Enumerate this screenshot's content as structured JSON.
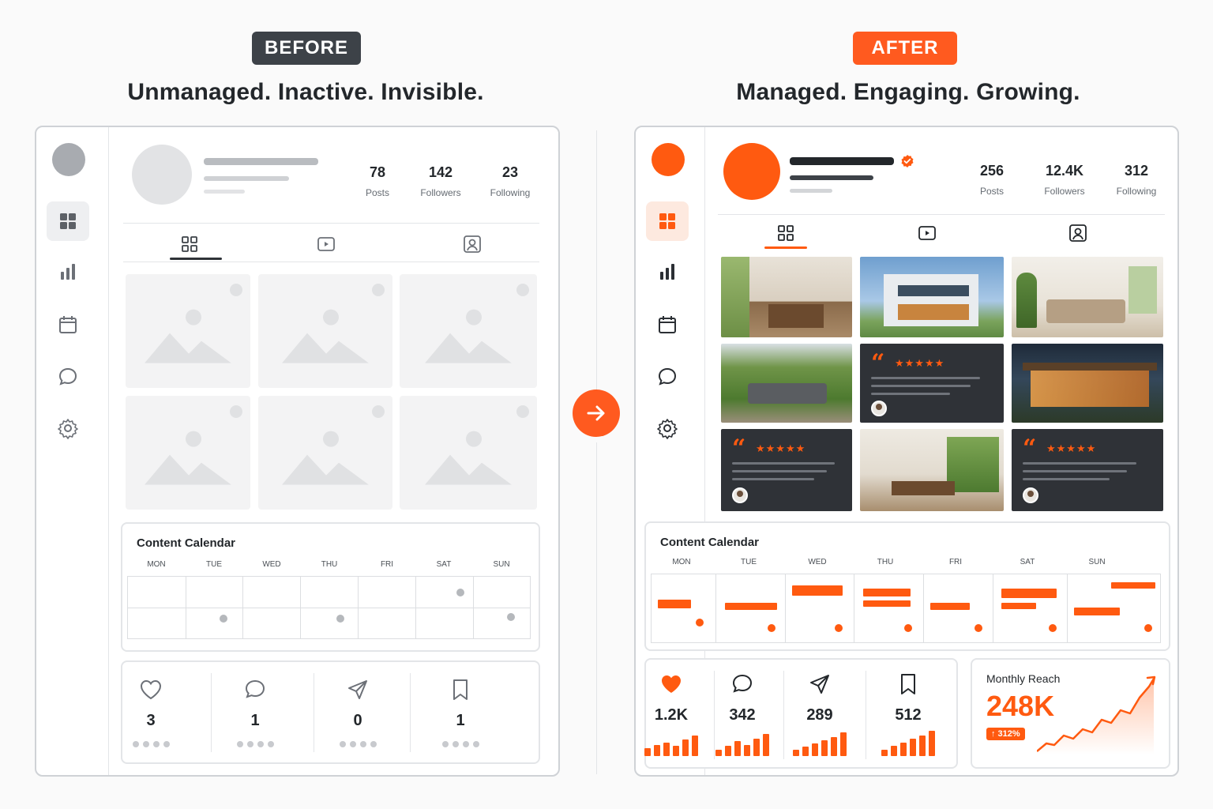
{
  "before": {
    "badge": "BEFORE",
    "tagline": "Unmanaged.  Inactive.  Invisible.",
    "stats": [
      {
        "value": "78",
        "label": "Posts"
      },
      {
        "value": "142",
        "label": "Followers"
      },
      {
        "value": "23",
        "label": "Following"
      }
    ],
    "calendar": {
      "title": "Content Calendar",
      "days": [
        "MON",
        "TUE",
        "WED",
        "THU",
        "FRI",
        "SAT",
        "SUN"
      ]
    },
    "engagement": [
      "3",
      "1",
      "0",
      "1"
    ]
  },
  "after": {
    "badge": "AFTER",
    "tagline": "Managed. Engaging. Growing.",
    "stats": [
      {
        "value": "256",
        "label": "Posts"
      },
      {
        "value": "12.4K",
        "label": "Followers"
      },
      {
        "value": "312",
        "label": "Following"
      }
    ],
    "calendar": {
      "title": "Content Calendar",
      "days": [
        "MON",
        "TUE",
        "WED",
        "THU",
        "FRI",
        "SAT",
        "SUN"
      ]
    },
    "engagement": [
      "1.2K",
      "342",
      "289",
      "512"
    ],
    "reviews": {
      "quote": "“",
      "stars": "★★★★★"
    },
    "reach": {
      "title": "Monthly Reach",
      "value": "248K",
      "growth": "↑ 312%"
    }
  },
  "icons": {
    "sidebar": [
      "grid-icon",
      "bar-chart-icon",
      "calendar-icon",
      "chat-icon",
      "gear-icon"
    ],
    "tabs": [
      "grid-icon",
      "video-icon",
      "tagged-user-icon"
    ],
    "engagement": [
      "heart-icon",
      "comment-icon",
      "send-icon",
      "bookmark-icon"
    ]
  },
  "colors": {
    "accent": "#ff5a10",
    "dark": "#3d4248",
    "muted": "#a8abb0"
  }
}
